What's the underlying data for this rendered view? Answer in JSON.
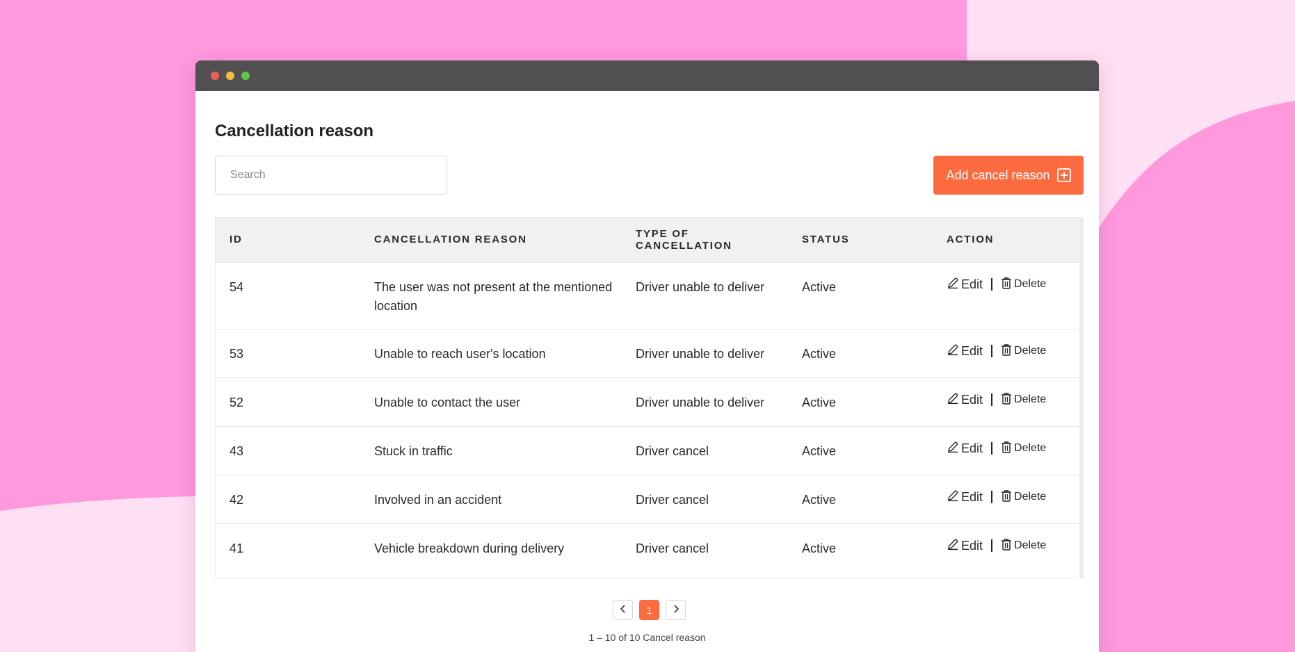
{
  "colors": {
    "background": "#ff98dc",
    "background_light": "#ffdff3",
    "accent": "#fc6b3f",
    "titlebar": "#505050"
  },
  "page": {
    "title": "Cancellation reason"
  },
  "search": {
    "placeholder": "Search",
    "value": ""
  },
  "toolbar": {
    "add_label": "Add cancel reason",
    "add_icon": "plus-square-icon"
  },
  "table": {
    "headers": [
      "ID",
      "CANCELLATION REASON",
      "TYPE OF CANCELLATION",
      "STATUS",
      "ACTION"
    ],
    "rows": [
      {
        "id": "54",
        "reason": "The user was not present at the mentioned location",
        "type": "Driver unable to deliver",
        "status": "Active"
      },
      {
        "id": "53",
        "reason": "Unable to reach user's location",
        "type": "Driver unable to deliver",
        "status": "Active"
      },
      {
        "id": "52",
        "reason": "Unable to contact the user",
        "type": "Driver unable to deliver",
        "status": "Active"
      },
      {
        "id": "43",
        "reason": "Stuck in traffic",
        "type": "Driver cancel",
        "status": "Active"
      },
      {
        "id": "42",
        "reason": "Involved in an accident",
        "type": "Driver cancel",
        "status": "Active"
      },
      {
        "id": "41",
        "reason": "Vehicle breakdown during delivery",
        "type": "Driver cancel",
        "status": "Active"
      }
    ],
    "edit_label": "Edit",
    "delete_label": "Delete",
    "edit_icon": "pencil-icon",
    "delete_icon": "trash-icon"
  },
  "pagination": {
    "current_page": "1",
    "info": "1 – 10 of 10 Cancel reason",
    "prev_icon": "chevron-left-icon",
    "next_icon": "chevron-right-icon"
  }
}
